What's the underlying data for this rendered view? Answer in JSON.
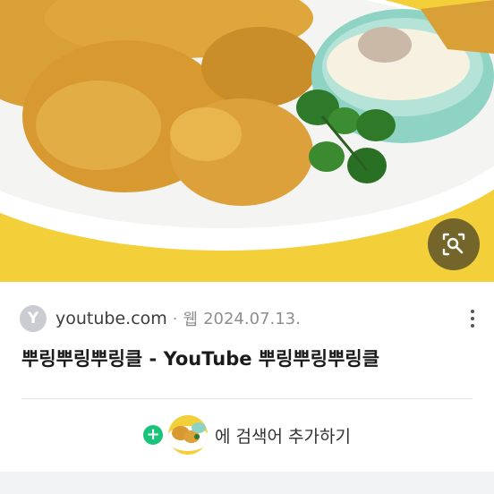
{
  "result": {
    "source": {
      "favicon_letter": "Y",
      "name": "youtube.com",
      "separator": "·",
      "type": "웹",
      "date": "2024.07.13."
    },
    "title": "뿌링뿌링뿌링클 - YouTube 뿌링뿌링뿌링클",
    "add_keyword": {
      "plus": "+",
      "label": "에 검색어 추가하기"
    }
  },
  "icons": {
    "lens": "image-search-icon",
    "more": "more-vertical-icon",
    "plus": "plus-circle-icon"
  },
  "colors": {
    "hero_background": "#f3cf3a",
    "plus_green": "#19c37a",
    "favicon_gray": "#c9ccd1"
  }
}
